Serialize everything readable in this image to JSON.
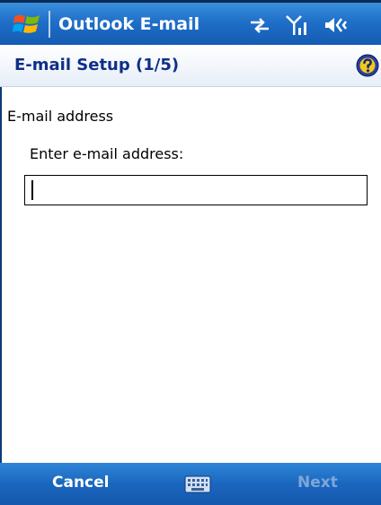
{
  "title_bar": {
    "app_title": "Outlook E-mail",
    "icons": [
      "windows-start-icon",
      "connectivity-icon",
      "signal-icon",
      "speaker-icon"
    ]
  },
  "header": {
    "page_title": "E-mail Setup (1/5)",
    "help_icon": "help-icon"
  },
  "form": {
    "section_label": "E-mail address",
    "field_label": "Enter e-mail address:",
    "email_value": "",
    "email_placeholder": ""
  },
  "menu": {
    "left_label": "Cancel",
    "right_label": "Next",
    "center_icon": "keyboard-icon"
  },
  "colors": {
    "title_bar": "#1f6fc8",
    "header_text": "#0f2f86",
    "menu_bar": "#1b66bf",
    "disabled_text": "#7ea7d8"
  }
}
